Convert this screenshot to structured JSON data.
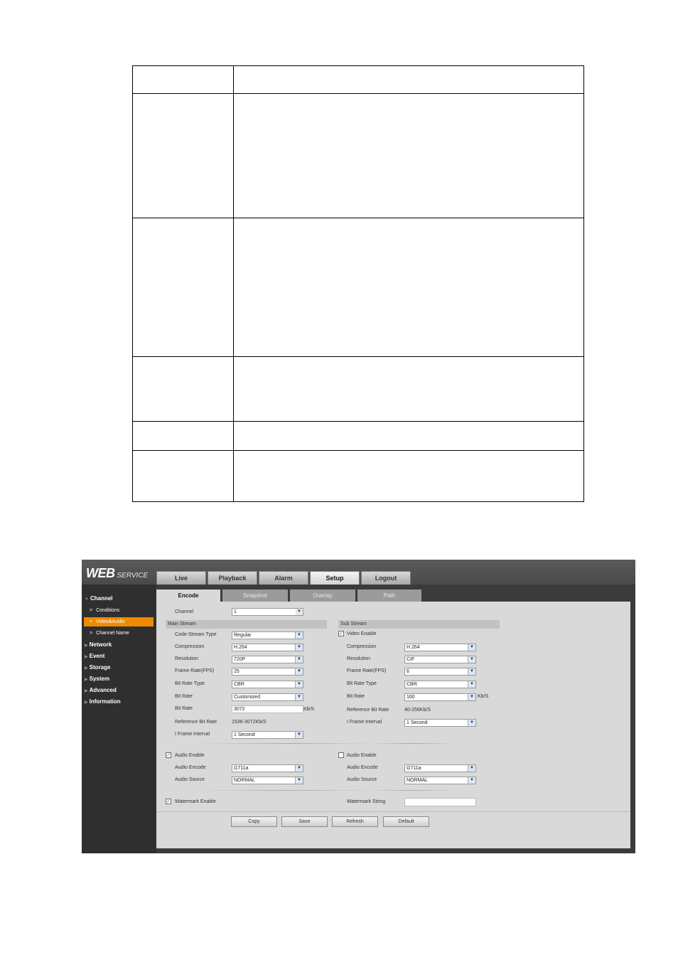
{
  "app": {
    "logo_main": "WEB",
    "logo_sub": "SERVICE"
  },
  "main_tabs": [
    "Live",
    "Playback",
    "Alarm",
    "Setup",
    "Logout"
  ],
  "sidebar": {
    "groups": [
      "Channel",
      "Network",
      "Event",
      "Storage",
      "System",
      "Advanced",
      "Information"
    ],
    "channel_items": [
      "Conditions",
      "Video&Audio",
      "Channel Name"
    ]
  },
  "sub_tabs": [
    "Encode",
    "Snapshot",
    "Overlay",
    "Path"
  ],
  "form": {
    "channel_label": "Channel",
    "channel_value": "1",
    "main_stream": {
      "title": "Main Stream",
      "code_stream_type_label": "Code-Stream Type",
      "code_stream_type": "Regular",
      "compression_label": "Compression",
      "compression": "H.264",
      "resolution_label": "Resolution",
      "resolution": "720P",
      "frame_rate_label": "Frame Rate(FPS)",
      "frame_rate": "25",
      "bit_rate_type_label": "Bit Rate Type",
      "bit_rate_type": "CBR",
      "bit_rate_label": "Bit Rate",
      "bit_rate_mode": "Customized",
      "bit_rate2_label": "Bit Rate",
      "bit_rate_value": "3072",
      "bit_rate_unit": "Kb/S",
      "ref_bit_rate_label": "Reference Bit Rate",
      "ref_bit_rate": "1536-3072Kb/S",
      "i_frame_label": "I Frame Interval",
      "i_frame": "1 Second"
    },
    "sub_stream": {
      "title": "Sub Stream",
      "video_enable_label": "Video Enable",
      "compression_label": "Compression",
      "compression": "H.264",
      "resolution_label": "Resolution",
      "resolution": "CIF",
      "frame_rate_label": "Frame Rate(FPS)",
      "frame_rate": "6",
      "bit_rate_type_label": "Bit Rate Type",
      "bit_rate_type": "CBR",
      "bit_rate_label": "Bit Rate",
      "bit_rate": "160",
      "bit_rate_unit": "Kb/S",
      "ref_bit_rate_label": "Reference Bit Rate",
      "ref_bit_rate": "40-256Kb/S",
      "i_frame_label": "I Frame Interval",
      "i_frame": "1 Second"
    },
    "audio_main": {
      "enable_label": "Audio Enable",
      "encode_label": "Audio Encode",
      "encode": "G711a",
      "source_label": "Audio Source",
      "source": "NORMAL"
    },
    "audio_sub": {
      "enable_label": "Audio Enable",
      "encode_label": "Audio Encode",
      "encode": "G711a",
      "source_label": "Audio Source",
      "source": "NORMAL"
    },
    "watermark_enable_label": "Watermark Enable",
    "watermark_string_label": "Watermark String",
    "watermark_string": ""
  },
  "buttons": [
    "Copy",
    "Save",
    "Refresh",
    "Default"
  ],
  "colors": {
    "active_sidebar": "#f08a00",
    "panel": "#d9d9d9",
    "sidebar_bg": "#2f2f2f"
  }
}
